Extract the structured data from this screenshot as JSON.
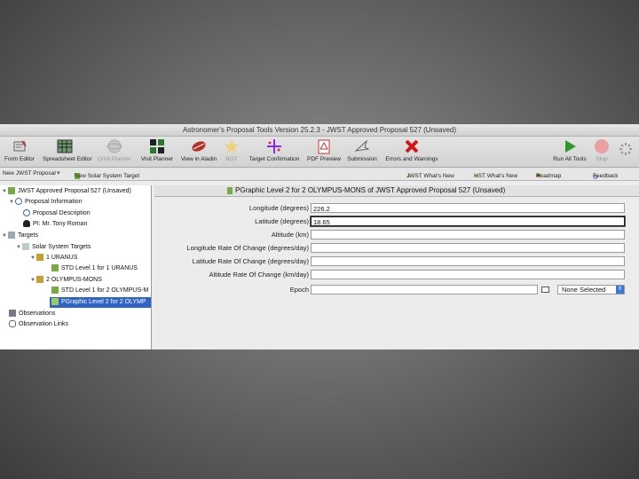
{
  "window": {
    "title": "Astronomer's Proposal Tools Version 25.2.3 - JWST Approved Proposal 527 (Unsaved)"
  },
  "toolbar": {
    "items": [
      {
        "label": "Form Editor",
        "icon": "form-editor-icon"
      },
      {
        "label": "Spreadsheet Editor",
        "icon": "spreadsheet-icon"
      },
      {
        "label": "Orbit Planner",
        "icon": "orbit-planner-icon"
      },
      {
        "label": "Visit Planner",
        "icon": "visit-planner-icon"
      },
      {
        "label": "View in Aladin",
        "icon": "aladin-icon"
      },
      {
        "label": "BOT",
        "icon": "bot-icon"
      },
      {
        "label": "Target Confirmation",
        "icon": "target-confirmation-icon"
      },
      {
        "label": "PDF Preview",
        "icon": "pdf-preview-icon"
      },
      {
        "label": "Submission",
        "icon": "submission-icon"
      },
      {
        "label": "Errors and Warnings",
        "icon": "errors-warnings-icon"
      },
      {
        "label": "Run All Tools",
        "icon": "run-all-icon"
      },
      {
        "label": "Stop",
        "icon": "stop-icon"
      }
    ]
  },
  "subbar": {
    "new_proposal": "New JWST Proposal",
    "new_target": "New Solar System Target",
    "jwst_whats_new": "JWST What's New",
    "hst_whats_new": "HST What's New",
    "roadmap": "Roadmap",
    "feedback": "Feedback"
  },
  "tree": [
    {
      "label": "JWST Approved Proposal 527 (Unsaved)",
      "level": 0,
      "expanded": true
    },
    {
      "label": "Proposal Information",
      "level": 1,
      "expanded": true
    },
    {
      "label": "Proposal Description",
      "level": 2
    },
    {
      "label": "PI: Mr. Tony Roman",
      "level": 2
    },
    {
      "label": "Targets",
      "level": 1,
      "expanded": true
    },
    {
      "label": "Solar System Targets",
      "level": 2,
      "expanded": true
    },
    {
      "label": "1 URANUS",
      "level": 3,
      "expanded": true
    },
    {
      "label": "STD Level 1 for 1 URANUS",
      "level": 4
    },
    {
      "label": "2 OLYMPUS-MONS",
      "level": 3,
      "expanded": true
    },
    {
      "label": "STD Level 1 for 2 OLYMPUS-M",
      "level": 4
    },
    {
      "label": "PGraphic Level 2 for 2 OLYMP",
      "level": 4,
      "selected": true
    },
    {
      "label": "Observations",
      "level": 1
    },
    {
      "label": "Observation Links",
      "level": 1
    }
  ],
  "form": {
    "heading": "PGraphic Level 2 for 2 OLYMPUS-MONS of JWST Approved Proposal 527 (Unsaved)",
    "fields": [
      {
        "label": "Longitude (degrees)",
        "value": "226.2"
      },
      {
        "label": "Latitude (degrees)",
        "value": "18.65",
        "focused": true
      },
      {
        "label": "Altitude (km)",
        "value": ""
      },
      {
        "label": "Longitude Rate Of Change (degrees/day)",
        "value": ""
      },
      {
        "label": "Latitude Rate Of Change (degrees/day)",
        "value": ""
      },
      {
        "label": "Altitude Rate Of Change (km/day)",
        "value": ""
      }
    ],
    "epoch": {
      "label": "Epoch",
      "value": "",
      "select": "None Selected"
    }
  }
}
